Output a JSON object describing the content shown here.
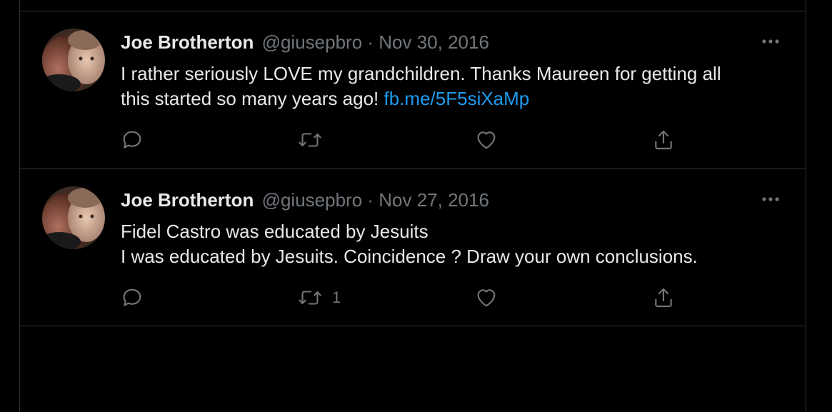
{
  "tweets": [
    {
      "author_name": "Joe Brotherton",
      "handle_date": "@giusepbro · Nov 30, 2016",
      "text_line1": "I rather seriously LOVE  my grandchildren.  Thanks Maureen for getting all",
      "text_line2_prefix": "this started so many years ago! ",
      "link": "fb.me/5F5siXaMp",
      "actions": {
        "reply_icon": "reply-icon",
        "retweet_icon": "retweet-icon",
        "retweet_count": "",
        "like_icon": "heart-icon",
        "share_icon": "share-icon"
      }
    },
    {
      "author_name": "Joe Brotherton",
      "handle_date": "@giusepbro · Nov 27, 2016",
      "text_line1": "Fidel Castro was educated by Jesuits",
      "text_line2": "I was educated by Jesuits.  Coincidence ?  Draw your own conclusions.",
      "actions": {
        "reply_icon": "reply-icon",
        "retweet_icon": "retweet-icon",
        "retweet_count": "1",
        "like_icon": "heart-icon",
        "share_icon": "share-icon"
      }
    }
  ],
  "colors": {
    "background": "#000000",
    "text": "#e7e9ea",
    "secondary": "#71767b",
    "link": "#1d9bf0",
    "border": "#2f3336"
  }
}
